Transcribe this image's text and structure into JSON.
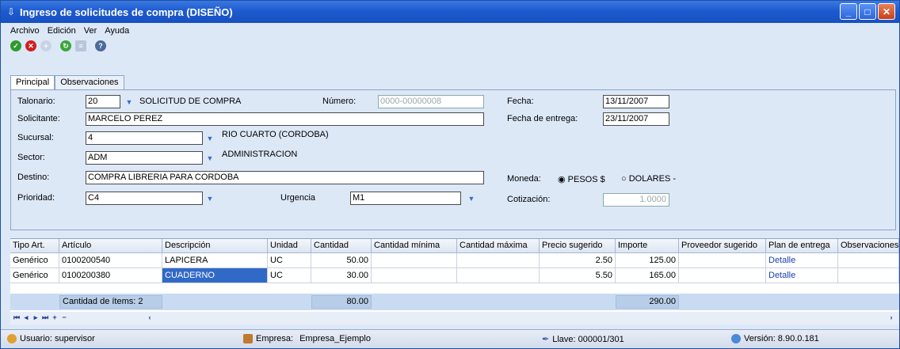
{
  "window": {
    "title": "Ingreso de solicitudes de compra (DISEÑO)",
    "min_label": "_",
    "max_label": "□",
    "close_label": "✕"
  },
  "menu": [
    "Archivo",
    "Edición",
    "Ver",
    "Ayuda"
  ],
  "toolbar_icons": [
    "ok-icon",
    "cancel-icon",
    "add-icon",
    "refresh-icon",
    "list-icon",
    "help-icon"
  ],
  "tabs": [
    "Principal",
    "Observaciones"
  ],
  "form": {
    "talonario_label": "Talonario:",
    "talonario_value": "20",
    "talonario_desc": "SOLICITUD DE COMPRA",
    "numero_label": "Número:",
    "numero_value": "0000-00000008",
    "fecha_label": "Fecha:",
    "fecha_value": "13/11/2007",
    "solicitante_label": "Solicitante:",
    "solicitante_value": "MARCELO PEREZ",
    "fecha_entrega_label": "Fecha de entrega:",
    "fecha_entrega_value": "23/11/2007",
    "sucursal_label": "Sucursal:",
    "sucursal_value": "4",
    "sucursal_desc": "RIO CUARTO (CORDOBA)",
    "sector_label": "Sector:",
    "sector_value": "ADM",
    "sector_desc": "ADMINISTRACION",
    "destino_label": "Destino:",
    "destino_value": "COMPRA LIBRERIA PARA CORDOBA",
    "moneda_label": "Moneda:",
    "moneda_opt1": "PESOS $",
    "moneda_opt2": "DOLARES -",
    "prioridad_label": "Prioridad:",
    "prioridad_value": "C4",
    "urgencia_label": "Urgencia",
    "urgencia_value": "M1",
    "cotizacion_label": "Cotización:",
    "cotizacion_value": "1.0000"
  },
  "grid": {
    "headers": [
      "Tipo Art.",
      "Artículo",
      "Descripción",
      "Unidad",
      "Cantidad",
      "Cantidad mínima",
      "Cantidad máxima",
      "Precio sugerido",
      "Importe",
      "Proveedor sugerido",
      "Plan de entrega",
      "Observaciones"
    ],
    "rows": [
      [
        "Genérico",
        "0100200540",
        "LAPICERA",
        "UC",
        "50.00",
        "",
        "",
        "2.50",
        "125.00",
        "",
        "Detalle",
        ""
      ],
      [
        "Genérico",
        "0100200380",
        "CUADERNO",
        "UC",
        "30.00",
        "",
        "",
        "5.50",
        "165.00",
        "",
        "Detalle",
        ""
      ]
    ]
  },
  "totals": {
    "items_label": "Cantidad de ítems: 2",
    "cantidad_total": "80.00",
    "importe_total": "290.00"
  },
  "status": {
    "usuario": "Usuario: supervisor",
    "empresa_label": "Empresa:",
    "empresa_value": "Empresa_Ejemplo",
    "llave": "Llave: 000001/301",
    "version": "Versión: 8.90.0.181"
  }
}
